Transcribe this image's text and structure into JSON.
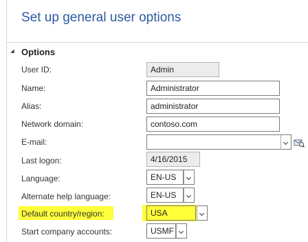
{
  "page": {
    "title": "Set up general user options"
  },
  "section": {
    "title": "Options",
    "expanded": true
  },
  "fields": {
    "user_id": {
      "label": "User ID:",
      "value": "Admin"
    },
    "name": {
      "label": "Name:",
      "value": "Administrator"
    },
    "alias": {
      "label": "Alias:",
      "value": "administrator"
    },
    "network_domain": {
      "label": "Network domain:",
      "value": "contoso.com"
    },
    "email": {
      "label": "E-mail:",
      "value": ""
    },
    "last_logon": {
      "label": "Last logon:",
      "value": "4/16/2015"
    },
    "language": {
      "label": "Language:",
      "value": "EN-US"
    },
    "alternate_help_language": {
      "label": "Alternate help language:",
      "value": "EN-US"
    },
    "default_country_region": {
      "label": "Default country/region:",
      "value": "USA"
    },
    "start_company_accounts": {
      "label": "Start company accounts:",
      "value": "USMF"
    }
  },
  "icons": {
    "section_toggle": "collapse-triangle-icon",
    "email_action": "email-lookup-icon",
    "dropdown": "chevron-down-icon"
  },
  "colors": {
    "title": "#2c5aa0",
    "highlight": "#ffff3a"
  }
}
